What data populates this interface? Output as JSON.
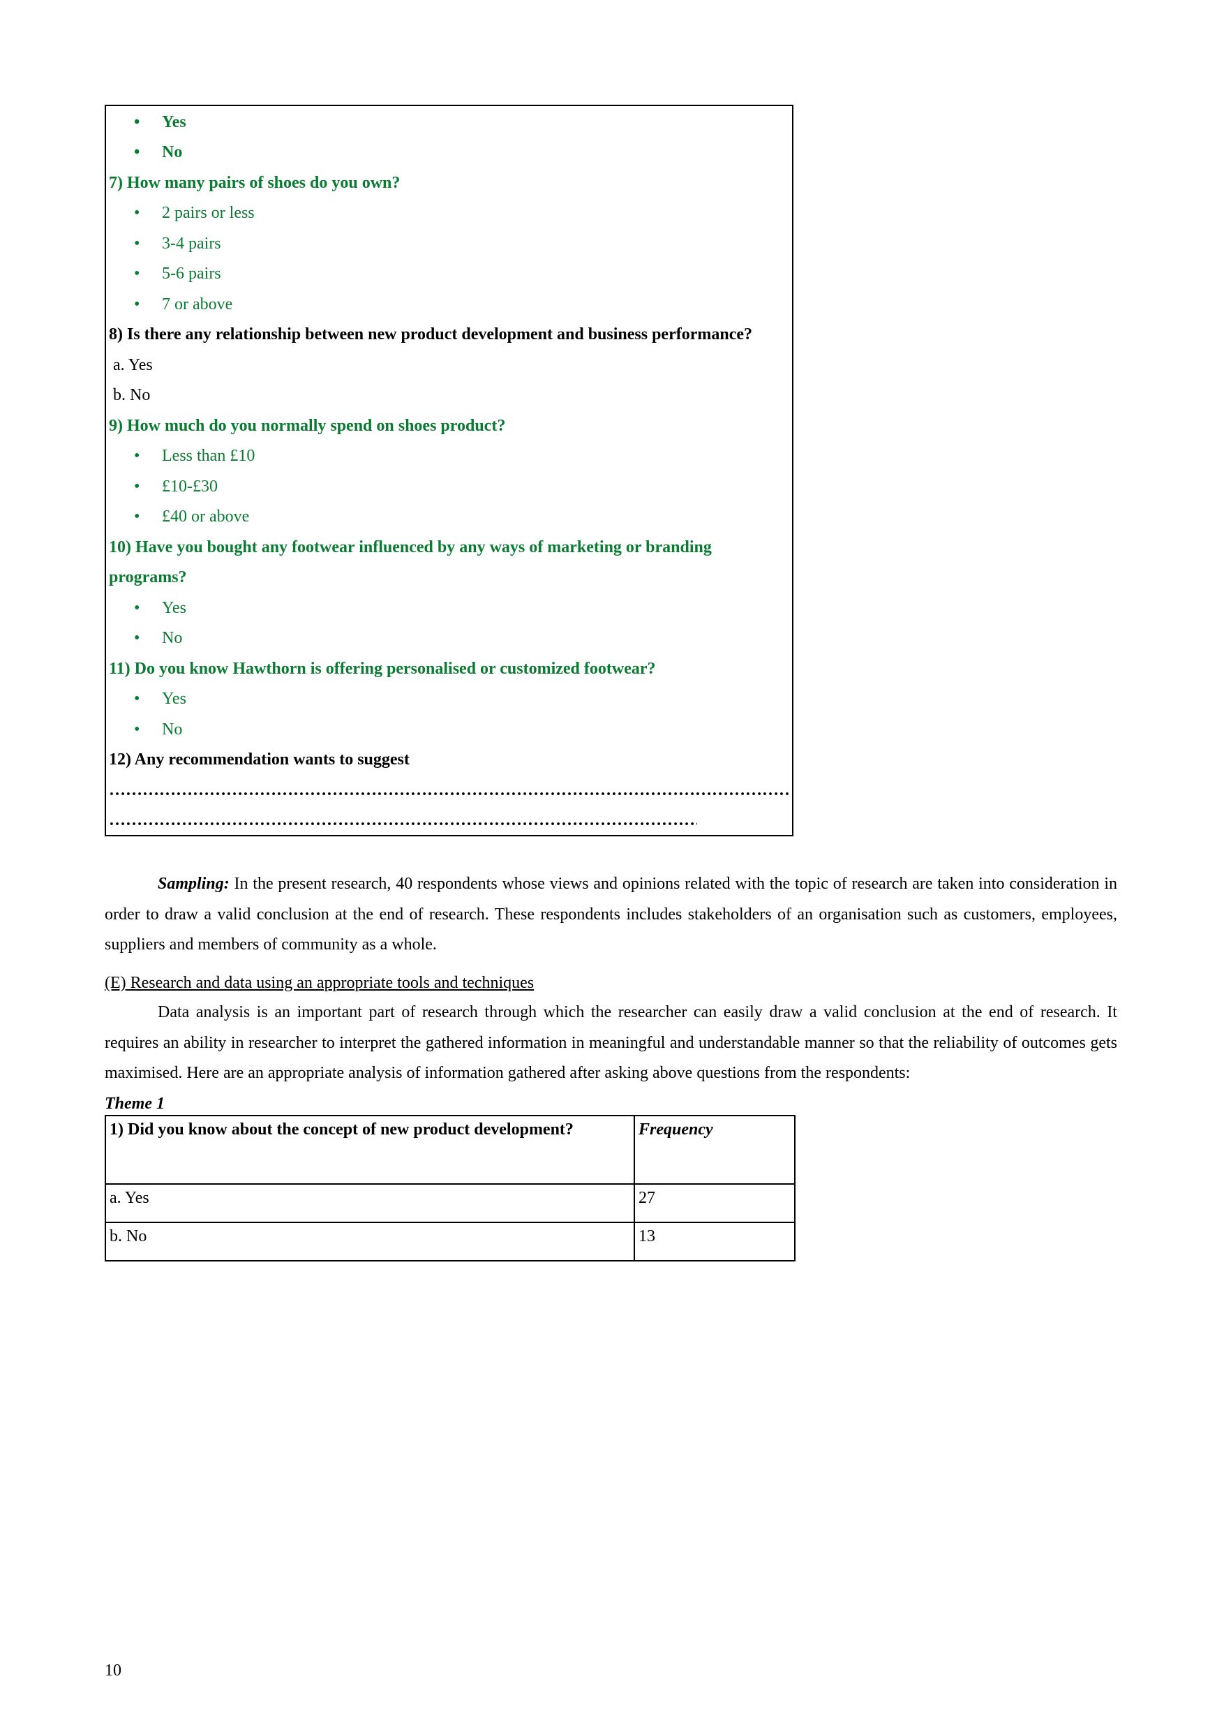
{
  "questionnaire": {
    "q6_options": [
      "Yes",
      "No"
    ],
    "q7": {
      "question": "7) How many pairs of shoes do you own?",
      "options": [
        "2 pairs or less",
        "3-4 pairs",
        "5-6 pairs",
        "7 or above"
      ]
    },
    "q8": {
      "question": "8) Is there any relationship between new product development and business performance?",
      "options": [
        "a. Yes",
        "b. No"
      ]
    },
    "q9": {
      "question": "9) How much do you normally spend on shoes product?",
      "options": [
        "Less than £10",
        "£10-£30",
        "£40 or above"
      ]
    },
    "q10": {
      "question_line1": "10)  Have you bought any footwear influenced by any ways of marketing or branding",
      "question_line2": "programs?",
      "options": [
        "Yes",
        "No"
      ]
    },
    "q11": {
      "question": "11) Do you know Hawthorn is offering personalised or customized footwear?",
      "options": [
        "Yes",
        "No"
      ]
    },
    "q12": {
      "question": "12) Any recommendation wants to suggest",
      "answer_line1": "………………………………………………………………………………………………………………………………………………………………………………………………………",
      "answer_line2": "…………………………………………………………………………………………………………………………………………………………………"
    },
    "bullet_glyph": "•",
    "accent_color": "#0b7a32"
  },
  "sampling": {
    "label": "Sampling:",
    "text": " In the present research, 40 respondents whose views and opinions related with the topic of research are taken into consideration in order to draw a valid conclusion at the end of research. These respondents includes stakeholders of an organisation such as customers, employees, suppliers and members of community as a whole."
  },
  "section_e": {
    "heading": "(E) Research and data using an appropriate tools and techniques",
    "paragraph": "Data analysis is an important part of research through which the researcher can easily draw a valid conclusion at the end of research. It requires an ability in researcher to interpret the gathered information in meaningful and understandable manner so that the reliability of outcomes gets maximised. Here are an appropriate analysis of information gathered after asking above questions from the respondents:"
  },
  "theme": {
    "title": "Theme 1",
    "table": {
      "question": "1) Did you know about the concept of new product development?",
      "frequency_header": "Frequency",
      "rows": [
        {
          "option": "a. Yes",
          "frequency": "27"
        },
        {
          "option": "b. No",
          "frequency": "13"
        }
      ]
    }
  },
  "page_number": "10"
}
